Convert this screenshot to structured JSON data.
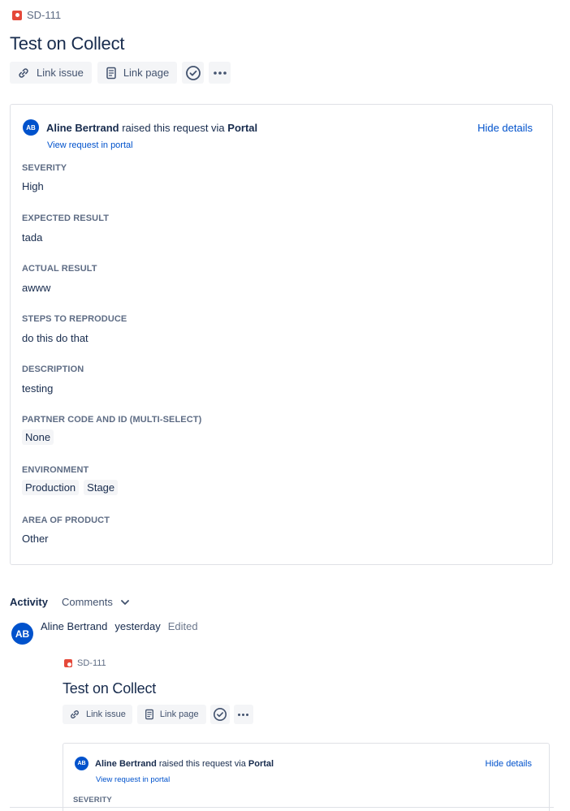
{
  "issue": {
    "key": "SD-111",
    "title": "Test on Collect",
    "toolbar": {
      "link_issue": "Link issue",
      "link_page": "Link page"
    }
  },
  "request": {
    "author": "Aline Bertrand",
    "avatar_initials": "AB",
    "raised_text": "raised this request via",
    "channel": "Portal",
    "view_link": "View request in portal",
    "hide_details": "Hide details"
  },
  "fields": [
    {
      "label": "SEVERITY",
      "value": "High"
    },
    {
      "label": "EXPECTED RESULT",
      "value": "tada"
    },
    {
      "label": "ACTUAL RESULT",
      "value": "awww"
    },
    {
      "label": "STEPS TO REPRODUCE",
      "value": "do this do that"
    },
    {
      "label": "DESCRIPTION",
      "value": "testing"
    },
    {
      "label": "PARTNER CODE AND ID (MULTI-SELECT)",
      "tags": [
        "None"
      ]
    },
    {
      "label": "ENVIRONMENT",
      "tags": [
        "Production",
        "Stage"
      ]
    },
    {
      "label": "AREA OF PRODUCT",
      "value": "Other"
    }
  ],
  "activity": {
    "label": "Activity",
    "filter": "Comments"
  },
  "comment": {
    "author": "Aline Bertrand",
    "when": "yesterday",
    "edited": "Edited",
    "avatar_initials": "AB",
    "embedded": {
      "key": "SD-111",
      "title": "Test on Collect",
      "link_issue": "Link issue",
      "link_page": "Link page",
      "author": "Aline Bertrand",
      "raised_text": "raised this request via",
      "channel": "Portal",
      "view_link": "View request in portal",
      "hide_details": "Hide details",
      "first_field_label": "SEVERITY"
    }
  },
  "colors": {
    "brand": "#0052cc",
    "bug": "#e5493a",
    "text": "#172b4d",
    "subtle": "#5e6c84",
    "border": "#dfe1e6"
  }
}
